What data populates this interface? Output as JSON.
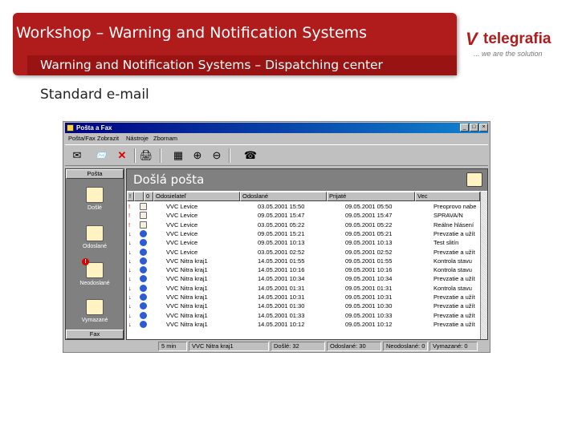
{
  "slide": {
    "title": "Workshop – Warning and Notification Systems",
    "subtitle_bar": "Warning and Notification Systems – Dispatching center",
    "caption": "Standard e-mail"
  },
  "logo": {
    "name": "telegrafia",
    "tagline": "... we are the solution",
    "color": "#b01c1c"
  },
  "window": {
    "title": "Pošta a Fax",
    "menu": [
      "Pošta/Fax",
      "Zobrazit",
      "Nástroje",
      "Zbornam"
    ],
    "toolbar_icons": [
      "compose-icon",
      "reply-icon",
      "delete-icon",
      "print-icon",
      "grid-icon",
      "zoom-in-icon",
      "zoom-out-icon",
      "fax-icon"
    ],
    "sidebar": {
      "header_top": "Pošta",
      "header_bottom": "Fax",
      "items": [
        {
          "label": "Došlé",
          "icon": "inbox-icon"
        },
        {
          "label": "Odoslané",
          "icon": "sent-icon"
        },
        {
          "label": "Neodoslané",
          "icon": "unsent-icon"
        },
        {
          "label": "Vymazané",
          "icon": "deleted-icon"
        }
      ]
    },
    "pane_title": "Došlá pošta",
    "columns": [
      "!",
      "",
      "0",
      "Odosielateľ",
      "Odoslané",
      "Prijaté",
      "Vec"
    ],
    "rows": [
      {
        "mark": "!",
        "sender": "VVC Levice",
        "sent": "03.05.2001 15:50",
        "received": "09.05.2001 05:50",
        "subject": "Preoprovo nabe"
      },
      {
        "mark": "!",
        "sender": "VVC Levice",
        "sent": "09.05.2001 15:47",
        "received": "09.05.2001 15:47",
        "subject": "SPRAVA/N"
      },
      {
        "mark": "!",
        "sender": "VVC Levice",
        "sent": "03.05.2001 05:22",
        "received": "09.05.2001 05:22",
        "subject": "Reálne hlásení"
      },
      {
        "mark": "↓",
        "sender": "VVC Levice",
        "sent": "09.05.2001 15:21",
        "received": "09.05.2001 05:21",
        "subject": "Prevzatie a užít"
      },
      {
        "mark": "↓",
        "sender": "VVC Levice",
        "sent": "09.05.2001 10:13",
        "received": "09.05.2001 10:13",
        "subject": "Test slitín"
      },
      {
        "mark": "↓",
        "sender": "VVC Levice",
        "sent": "03.05.2001 02:52",
        "received": "09.05.2001 02:52",
        "subject": "Prevzatie a užít"
      },
      {
        "mark": "↓",
        "sender": "VVC Nitra kraj1",
        "sent": "14.05.2001 01:55",
        "received": "09.05.2001 01:55",
        "subject": "Kontrola stavu"
      },
      {
        "mark": "↓",
        "sender": "VVC Nitra kraj1",
        "sent": "14.05.2001 10:16",
        "received": "09.05.2001 10:16",
        "subject": "Kontrola stavu"
      },
      {
        "mark": "↓",
        "sender": "VVC Nitra kraj1",
        "sent": "14.05.2001 10:34",
        "received": "09.05.2001 10:34",
        "subject": "Prevzatie a užít"
      },
      {
        "mark": "↓",
        "sender": "VVC Nitra kraj1",
        "sent": "14.05.2001 01:31",
        "received": "09.05.2001 01:31",
        "subject": "Kontrola stavu"
      },
      {
        "mark": "↓",
        "sender": "VVC Nitra kraj1",
        "sent": "14.05.2001 10:31",
        "received": "09.05.2001 10:31",
        "subject": "Prevzatie a užít"
      },
      {
        "mark": "↓",
        "sender": "VVC Nitra kraj1",
        "sent": "14.05.2001 01:30",
        "received": "09.05.2001 10:30",
        "subject": "Prevzatie a užít"
      },
      {
        "mark": "↓",
        "sender": "VVC Nitra kraj1",
        "sent": "14.05.2001 01:33",
        "received": "09.05.2001 10:33",
        "subject": "Prevzatie a užít"
      },
      {
        "mark": "↓",
        "sender": "VVC Nitra kraj1",
        "sent": "14.05.2001 10:12",
        "received": "09.05.2001 10:12",
        "subject": "Prevzatie a užít"
      }
    ],
    "status": {
      "item1": "5 min",
      "item2": "VVC Nitra kraj1",
      "item3": "Došlé: 32",
      "item4": "Odoslané: 30",
      "item5": "Neodoslané: 0",
      "item6": "Vymazané: 0"
    }
  }
}
